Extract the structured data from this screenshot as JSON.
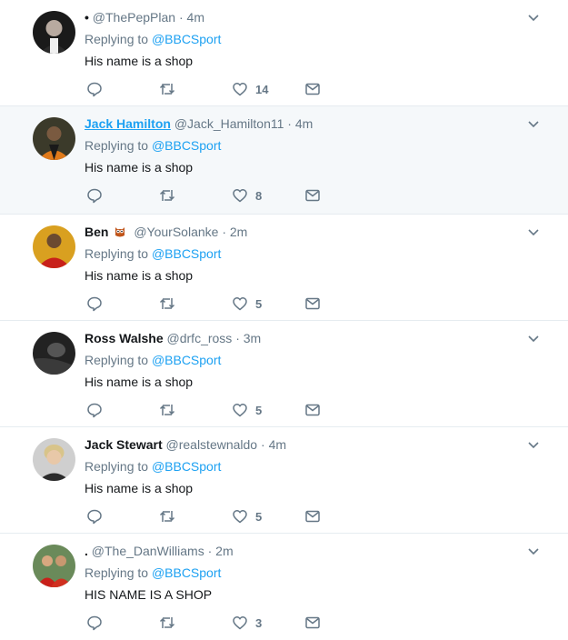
{
  "tweets": [
    {
      "display_name": "•",
      "handle": "@ThePepPlan",
      "time": "4m",
      "replying_prefix": "Replying to",
      "reply_to": "@BBCSport",
      "text": "His name is a shop",
      "likes": "14",
      "emoji": ""
    },
    {
      "display_name": "Jack Hamilton",
      "handle": "@Jack_Hamilton11",
      "time": "4m",
      "replying_prefix": "Replying to",
      "reply_to": "@BBCSport",
      "text": "His name is a shop",
      "likes": "8",
      "emoji": ""
    },
    {
      "display_name": "Ben",
      "handle": "@YourSolanke",
      "time": "2m",
      "replying_prefix": "Replying to",
      "reply_to": "@BBCSport",
      "text": "His name is a shop",
      "likes": "5",
      "emoji": "owl-emoji"
    },
    {
      "display_name": "Ross Walshe",
      "handle": "@drfc_ross",
      "time": "3m",
      "replying_prefix": "Replying to",
      "reply_to": "@BBCSport",
      "text": "His name is a shop",
      "likes": "5",
      "emoji": ""
    },
    {
      "display_name": "Jack Stewart",
      "handle": "@realstewnaldo",
      "time": "4m",
      "replying_prefix": "Replying to",
      "reply_to": "@BBCSport",
      "text": "His name is a shop",
      "likes": "5",
      "emoji": ""
    },
    {
      "display_name": ".",
      "handle": "@The_DanWilliams",
      "time": "2m",
      "replying_prefix": "Replying to",
      "reply_to": "@BBCSport",
      "text": "HIS NAME IS A SHOP",
      "likes": "3",
      "emoji": ""
    }
  ],
  "separator": "·",
  "colors": {
    "link": "#1da1f2",
    "muted": "#657786",
    "text": "#14171a",
    "highlight_bg": "#f5f8fa",
    "border": "#e6ecf0"
  },
  "icons": {
    "reply": "reply-icon",
    "retweet": "retweet-icon",
    "like": "heart-icon",
    "dm": "envelope-icon",
    "menu": "chevron-down-icon"
  }
}
